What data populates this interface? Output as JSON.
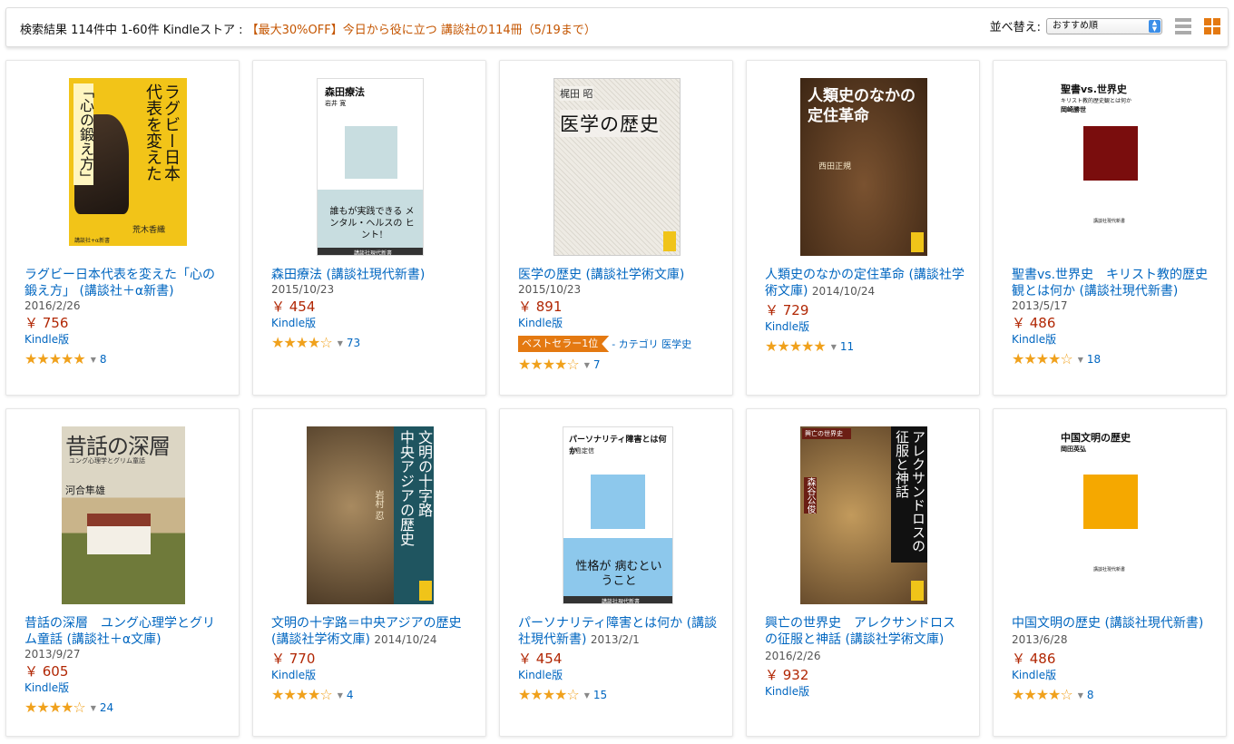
{
  "header": {
    "results_text": "検索結果 114件中 1-60件 Kindleストア :",
    "promo_text": "【最大30%OFF】今日から役に立つ 講談社の114冊（5/19まで）",
    "sort_label": "並べ替え:",
    "sort_value": "おすすめ順"
  },
  "products": [
    {
      "title": "ラグビー日本代表を変えた「心の鍛え方」 (講談社＋α新書)",
      "date": "2016/2/26",
      "price": "￥ 756",
      "format": "Kindle版",
      "stars": "★★★★★",
      "rating_value": 5,
      "review_count": "8",
      "cover": {
        "bg": "#f2c418",
        "title_lines": [
          "ラグビー日本",
          "代表を変えた",
          "「心の鍛え方」"
        ],
        "author": "荒木香織",
        "imprint": "講談社+α新書"
      }
    },
    {
      "title": "森田療法 (講談社現代新書)",
      "date": "2015/10/23",
      "price": "￥ 454",
      "format": "Kindle版",
      "stars": "★★★★☆",
      "rating_value": 4.5,
      "review_count": "73",
      "cover": {
        "bg": "#ffffff",
        "title": "森田療法",
        "author": "岩井 寛",
        "square_color": "#c8dde0",
        "lower_text": "誰もが実践できる メンタル・ヘルスの ヒント!",
        "imprint": "講談社現代新書"
      }
    },
    {
      "title": "医学の歴史 (講談社学術文庫)",
      "date": "2015/10/23",
      "price": "￥ 891",
      "format": "Kindle版",
      "bestseller_badge": "ベストセラー1位",
      "bestseller_category": "- カテゴリ 医学史",
      "stars": "★★★★☆",
      "rating_value": 4.5,
      "review_count": "7",
      "cover": {
        "bg": "#f3f1ec",
        "author": "梶田 昭",
        "title": "医学の歴史"
      }
    },
    {
      "title": "人類史のなかの定住革命 (講談社学術文庫)",
      "date": "2014/10/24",
      "price": "￥ 729",
      "format": "Kindle版",
      "stars": "★★★★★",
      "rating_value": 5,
      "review_count": "11",
      "cover": {
        "bg": "#5d3a1f",
        "title_lines": [
          "人類史のなかの",
          "定住革命"
        ],
        "author": "西田正規"
      }
    },
    {
      "title": "聖書vs.世界史　キリスト教的歴史観とは何か (講談社現代新書)",
      "date": "2013/5/17",
      "price": "￥ 486",
      "format": "Kindle版",
      "stars": "★★★★☆",
      "rating_value": 4.5,
      "review_count": "18",
      "cover": {
        "bg": "#ffffff",
        "title": "聖書vs.世界史",
        "subtitle": "キリスト教的歴史観とは何か",
        "author": "岡崎勝世",
        "square_color": "#7a0d0d",
        "imprint": "講談社現代新書"
      }
    },
    {
      "title": "昔話の深層　ユング心理学とグリム童話 (講談社＋α文庫)",
      "date": "2013/9/27",
      "price": "￥ 605",
      "format": "Kindle版",
      "stars": "★★★★☆",
      "rating_value": 4.5,
      "review_count": "24",
      "cover": {
        "bg": "#e7e2d2",
        "title": "昔話の深層",
        "subtitle": "ユング心理学とグリム童話",
        "author": "河合隼雄"
      }
    },
    {
      "title": "文明の十字路＝中央アジアの歴史 (講談社学術文庫)",
      "date": "2014/10/24",
      "price": "￥ 770",
      "format": "Kindle版",
      "stars": "★★★★☆",
      "rating_value": 4.5,
      "review_count": "4",
      "cover": {
        "bg": "#5a4530",
        "title_lines": [
          "文明の十字路",
          "中央アジアの歴史"
        ],
        "author": "岩村 忍"
      }
    },
    {
      "title": "パーソナリティ障害とは何か (講談社現代新書)",
      "date": "2013/2/1",
      "price": "￥ 454",
      "format": "Kindle版",
      "stars": "★★★★☆",
      "rating_value": 4.5,
      "review_count": "15",
      "cover": {
        "bg": "#ffffff",
        "title": "パーソナリティ障害とは何か",
        "author": "牛島定信",
        "square_color": "#8dc8ec",
        "lower_text": "性格が 病むということ",
        "imprint": "講談社現代新書"
      }
    },
    {
      "title": "興亡の世界史　アレクサンドロスの征服と神話 (講談社学術文庫)",
      "date": "2016/2/26",
      "price": "￥ 932",
      "format": "Kindle版",
      "cover": {
        "bg": "#8a6b3c",
        "series": "興亡の世界史",
        "title_lines": [
          "アレクサンドロスの",
          "征服と神話"
        ],
        "author": "森谷公俊"
      }
    },
    {
      "title": "中国文明の歴史 (講談社現代新書)",
      "date": "2013/6/28",
      "price": "￥ 486",
      "format": "Kindle版",
      "stars": "★★★★☆",
      "rating_value": 4.5,
      "review_count": "8",
      "cover": {
        "bg": "#ffffff",
        "title": "中国文明の歴史",
        "author": "岡田英弘",
        "square_color": "#f5a800",
        "imprint": "講談社現代新書"
      }
    }
  ]
}
